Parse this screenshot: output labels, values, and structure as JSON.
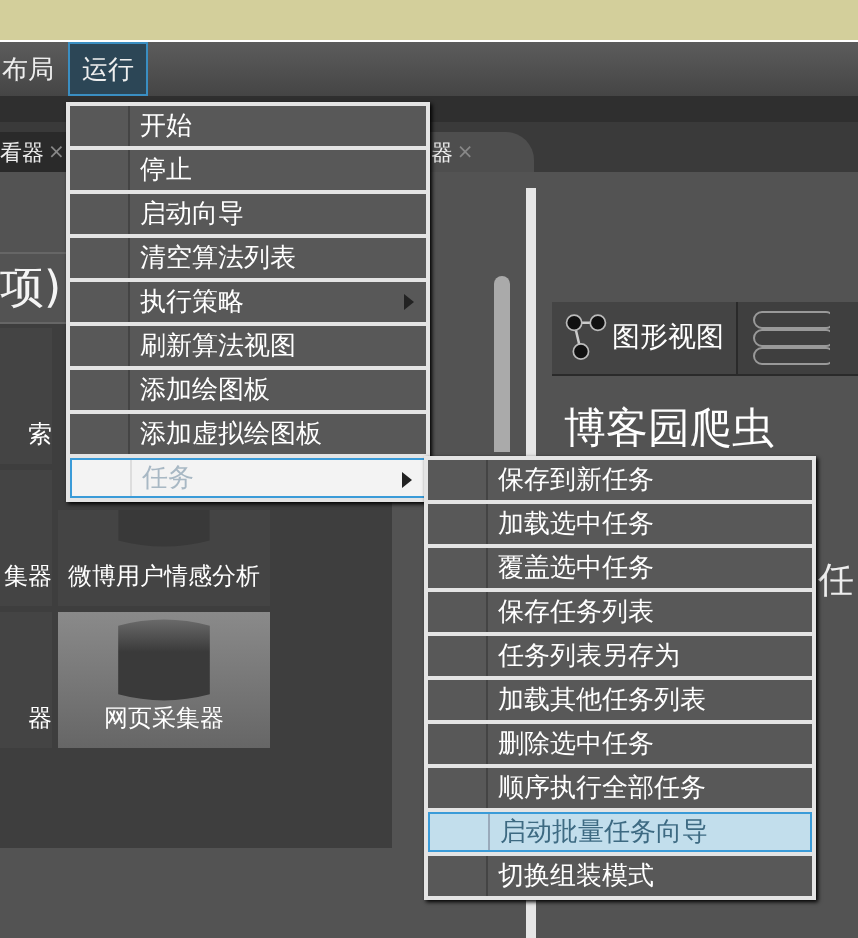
{
  "menu_bar": [
    {
      "label": "布局",
      "selected": false
    },
    {
      "label": "运行",
      "selected": true
    }
  ],
  "tabs": [
    {
      "label": "看器",
      "close": "×"
    },
    {
      "label": "器",
      "close": "×"
    }
  ],
  "left_panel": {
    "header": "项)",
    "columns": [
      [
        {
          "label": "索",
          "selected": false
        },
        {
          "label": "集器",
          "selected": false
        },
        {
          "label": "器",
          "selected": false
        }
      ],
      [
        {
          "label": "微博用户情感分析",
          "selected": false
        },
        {
          "label": "网页采集器",
          "selected": true
        }
      ]
    ]
  },
  "right_panel": {
    "toolbar": [
      {
        "label": "图形视图"
      }
    ],
    "title": "博客园爬虫",
    "fragment": "任"
  },
  "run_menu": [
    {
      "label": "开始",
      "submenu": false,
      "selected": false
    },
    {
      "label": "停止",
      "submenu": false,
      "selected": false
    },
    {
      "label": "启动向导",
      "submenu": false,
      "selected": false
    },
    {
      "label": "清空算法列表",
      "submenu": false,
      "selected": false
    },
    {
      "label": "执行策略",
      "submenu": true,
      "selected": false
    },
    {
      "label": "刷新算法视图",
      "submenu": false,
      "selected": false
    },
    {
      "label": "添加绘图板",
      "submenu": false,
      "selected": false
    },
    {
      "label": "添加虚拟绘图板",
      "submenu": false,
      "selected": false
    },
    {
      "label": "任务",
      "submenu": true,
      "selected": true
    }
  ],
  "task_menu": [
    {
      "label": "保存到新任务",
      "selected": false
    },
    {
      "label": "加载选中任务",
      "selected": false
    },
    {
      "label": "覆盖选中任务",
      "selected": false
    },
    {
      "label": "保存任务列表",
      "selected": false
    },
    {
      "label": "任务列表另存为",
      "selected": false
    },
    {
      "label": "加载其他任务列表",
      "selected": false
    },
    {
      "label": "删除选中任务",
      "selected": false
    },
    {
      "label": "顺序执行全部任务",
      "selected": false
    },
    {
      "label": "启动批量任务向导",
      "selected": true
    },
    {
      "label": "切换组装模式",
      "selected": false
    }
  ]
}
